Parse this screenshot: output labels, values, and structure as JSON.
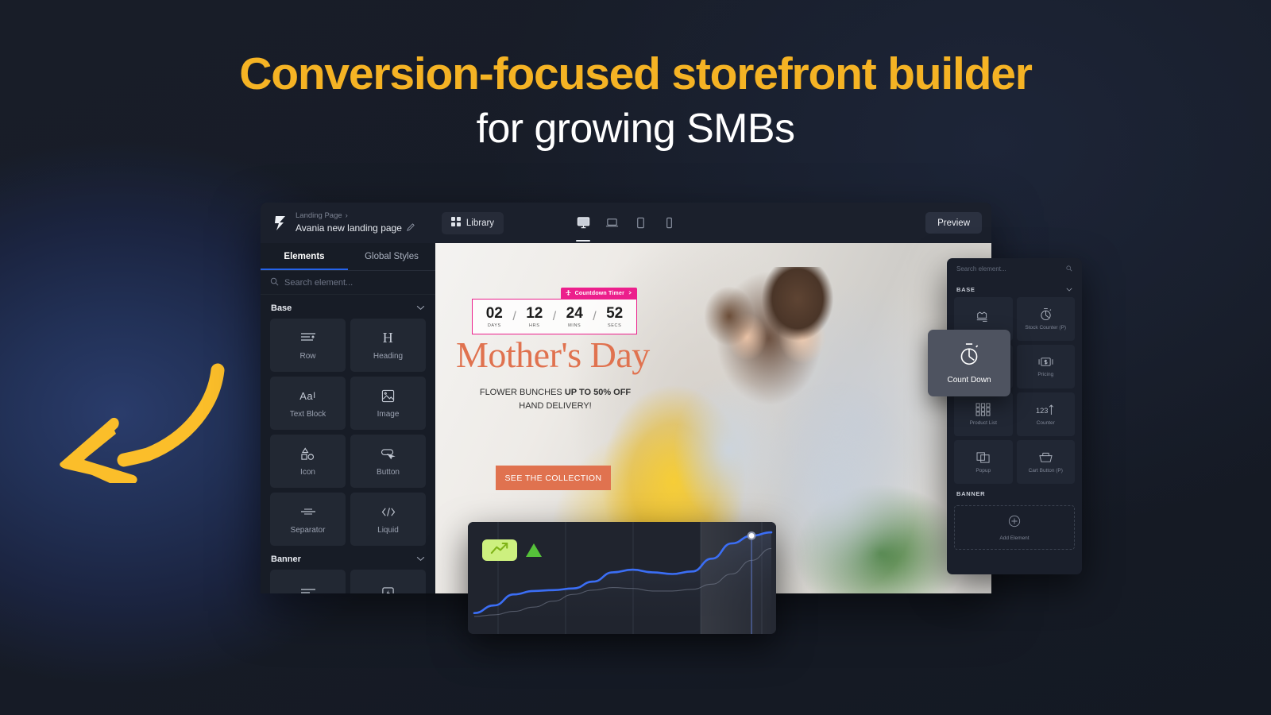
{
  "headline": {
    "line1": "Conversion-focused storefront builder",
    "line2": "for growing SMBs",
    "accent_color": "#f5b324"
  },
  "app": {
    "breadcrumb": {
      "parent": "Landing Page",
      "chevron": "›",
      "page_name": "Avania new landing page",
      "edit_icon": "pencil-icon"
    },
    "library_button": "Library",
    "preview_button": "Preview",
    "devices": [
      {
        "name": "desktop",
        "active": true
      },
      {
        "name": "laptop",
        "active": false
      },
      {
        "name": "tablet",
        "active": false
      },
      {
        "name": "mobile",
        "active": false
      }
    ]
  },
  "sidebar": {
    "tabs": [
      {
        "label": "Elements",
        "active": true
      },
      {
        "label": "Global Styles",
        "active": false
      }
    ],
    "search_placeholder": "Search element...",
    "sections": [
      {
        "title": "Base",
        "items": [
          {
            "label": "Row",
            "icon": "row-icon"
          },
          {
            "label": "Heading",
            "icon": "heading-icon"
          },
          {
            "label": "Text Block",
            "icon": "text-block-icon"
          },
          {
            "label": "Image",
            "icon": "image-icon"
          },
          {
            "label": "Icon",
            "icon": "shapes-icon"
          },
          {
            "label": "Button",
            "icon": "button-icon"
          },
          {
            "label": "Separator",
            "icon": "separator-icon"
          },
          {
            "label": "Liquid",
            "icon": "code-icon"
          }
        ]
      },
      {
        "title": "Banner",
        "items": [
          {
            "label": "",
            "icon": "row-icon"
          },
          {
            "label": "",
            "icon": "flash-icon"
          }
        ]
      }
    ]
  },
  "canvas": {
    "countdown": {
      "badge_label": "Countdown Timer",
      "badge_color": "#ec1f8c",
      "units": [
        {
          "value": "02",
          "label": "DAYS"
        },
        {
          "value": "12",
          "label": "HRS"
        },
        {
          "value": "24",
          "label": "MINS"
        },
        {
          "value": "52",
          "label": "SECS"
        }
      ],
      "separator": "/"
    },
    "hero_title": "Mother's Day",
    "hero_sub_prefix": "FLOWER BUNCHES ",
    "hero_sub_strong": "UP TO 50% OFF",
    "hero_sub_line2": "HAND DELIVERY!",
    "cta_label": "SEE THE COLLECTION",
    "cta_color": "#e0724f"
  },
  "right_panel": {
    "search_placeholder": "Search element...",
    "search_icon": "search-icon",
    "sections": [
      {
        "title": "BASE",
        "items": [
          {
            "label": "",
            "icon": "stock-icon"
          },
          {
            "label": "Stock Counter (P)",
            "icon": "stopwatch-icon"
          },
          {
            "label": "",
            "icon": "blank-icon"
          },
          {
            "label": "Pricing",
            "icon": "money-icon"
          },
          {
            "label": "Product List",
            "icon": "grid-icon"
          },
          {
            "label": "Counter",
            "icon": "counter-123-icon"
          },
          {
            "label": "Popup",
            "icon": "popup-icon"
          },
          {
            "label": "Cart Button (P)",
            "icon": "cart-icon"
          }
        ]
      },
      {
        "title": "BANNER",
        "items": []
      }
    ],
    "add_element_label": "Add Element"
  },
  "drag_card": {
    "label": "Count Down",
    "icon": "stopwatch-icon"
  },
  "chart_data": {
    "type": "line",
    "title": "",
    "xlabel": "",
    "ylabel": "",
    "grid": true,
    "legend": "none",
    "series": [
      {
        "name": "primary",
        "color": "#3b6ef5",
        "values": [
          4,
          13,
          26,
          30,
          31,
          33,
          41,
          52,
          55,
          52,
          50,
          53,
          68,
          86,
          95,
          99
        ]
      },
      {
        "name": "secondary",
        "color": "#7e8597",
        "values": [
          0,
          2,
          6,
          11,
          18,
          26,
          31,
          34,
          33,
          30,
          30,
          32,
          38,
          50,
          66,
          80
        ]
      }
    ],
    "x": [
      0,
      1,
      2,
      3,
      4,
      5,
      6,
      7,
      8,
      9,
      10,
      11,
      12,
      13,
      14,
      15
    ],
    "ylim": [
      0,
      100
    ],
    "marker": {
      "x": 14,
      "y": 95,
      "color": "#ffffff"
    },
    "badge_icon": "trend-up-icon",
    "badge_color": "#cdf07f",
    "triangle_color": "#56c23a"
  }
}
